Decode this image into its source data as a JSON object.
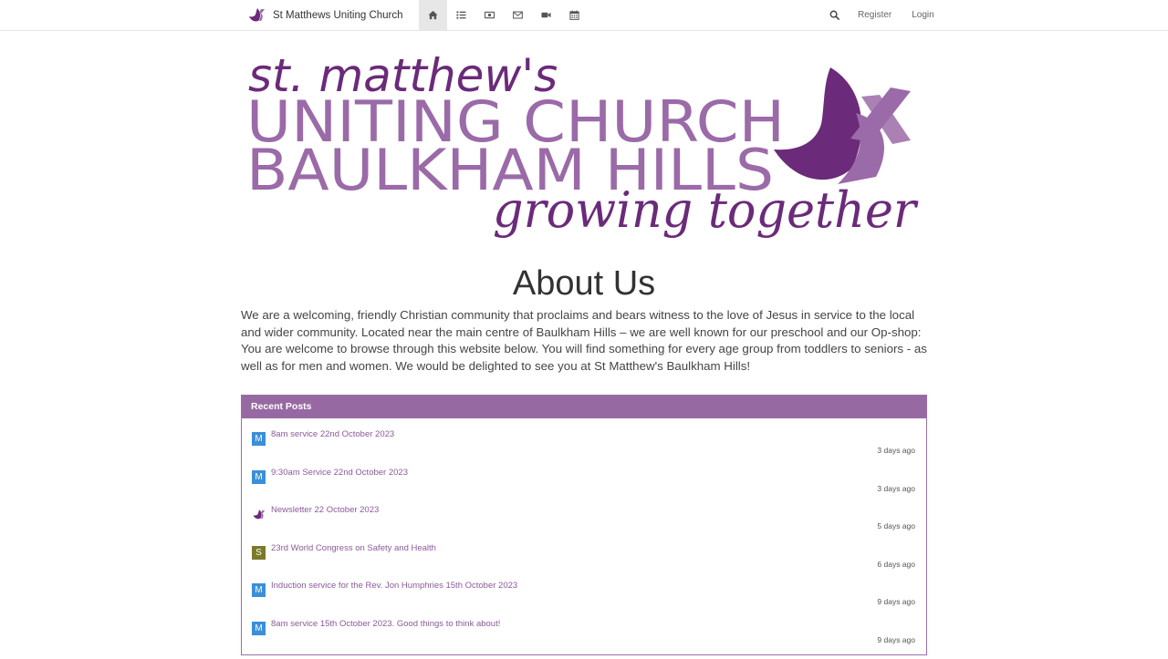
{
  "navbar": {
    "brand": "St Matthews Uniting Church",
    "icons": [
      "home-icon",
      "list-icon",
      "money-icon",
      "envelope-icon",
      "video-camera-icon",
      "calendar-icon"
    ],
    "register_label": "Register",
    "login_label": "Login"
  },
  "banner": {
    "line1": "st. matthew's",
    "line2": "UNITING CHURCH",
    "line3": "BAULKHAM HILLS",
    "line4": "growing together"
  },
  "about": {
    "title": "About Us",
    "text": "We are a welcoming, friendly Christian community that proclaims and bears witness to the love of Jesus in service to the local and wider community. Located near the main centre of Baulkham Hills – we are well known for our preschool and our Op-shop: You are welcome to browse through this website below. You will find something for every age group from toddlers to seniors - as well as for men and women. We would be delighted to see you at St Matthew's Baulkham Hills!"
  },
  "recent_posts": {
    "header": "Recent Posts",
    "items": [
      {
        "badge": "M",
        "badge_color": "#3b8fd9",
        "title": "8am service 22nd October 2023",
        "time": "3 days ago"
      },
      {
        "badge": "M",
        "badge_color": "#3b8fd9",
        "title": "9:30am Service 22nd October 2023",
        "time": "3 days ago"
      },
      {
        "badge": "",
        "badge_color": "",
        "title": "Newsletter 22 October 2023",
        "time": "5 days ago"
      },
      {
        "badge": "S",
        "badge_color": "#7a7a2a",
        "title": "23rd World Congress on Safety and Health",
        "time": "6 days ago"
      },
      {
        "badge": "M",
        "badge_color": "#3b8fd9",
        "title": "Induction service for the Rev. Jon Humphries 15th October 2023",
        "time": "9 days ago"
      },
      {
        "badge": "M",
        "badge_color": "#3b8fd9",
        "title": "8am service 15th October 2023. Good things to think about!",
        "time": "9 days ago"
      }
    ]
  },
  "colors": {
    "purple_dark": "#6b2a7a",
    "purple_light": "#9b6aa8",
    "panel_header": "#9769a2"
  }
}
